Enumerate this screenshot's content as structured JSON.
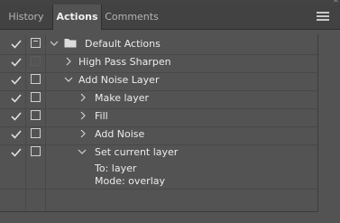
{
  "tabs": [
    {
      "label": "History"
    },
    {
      "label": "Actions"
    },
    {
      "label": "Comments"
    }
  ],
  "active_tab": "Actions",
  "menu_icon": "hamburger-menu-icon",
  "rows": [
    {
      "label": "Default Actions",
      "type": "set",
      "expanded": true,
      "checked": true,
      "dialog": "mark"
    },
    {
      "label": "High Pass Sharpen",
      "type": "action",
      "expanded": false,
      "checked": true,
      "dialog": "off"
    },
    {
      "label": "Add Noise Layer",
      "type": "action",
      "expanded": true,
      "checked": true,
      "dialog": "box"
    },
    {
      "label": "Make layer",
      "type": "step",
      "expanded": false,
      "checked": true,
      "dialog": "box"
    },
    {
      "label": "Fill",
      "type": "step",
      "expanded": false,
      "checked": true,
      "dialog": "box"
    },
    {
      "label": "Add Noise",
      "type": "step",
      "expanded": false,
      "checked": true,
      "dialog": "box"
    },
    {
      "label": "Set current layer",
      "type": "step",
      "expanded": true,
      "checked": true,
      "dialog": "box"
    }
  ],
  "details": [
    {
      "text": "To: layer"
    },
    {
      "text": "Mode: overlay"
    }
  ]
}
